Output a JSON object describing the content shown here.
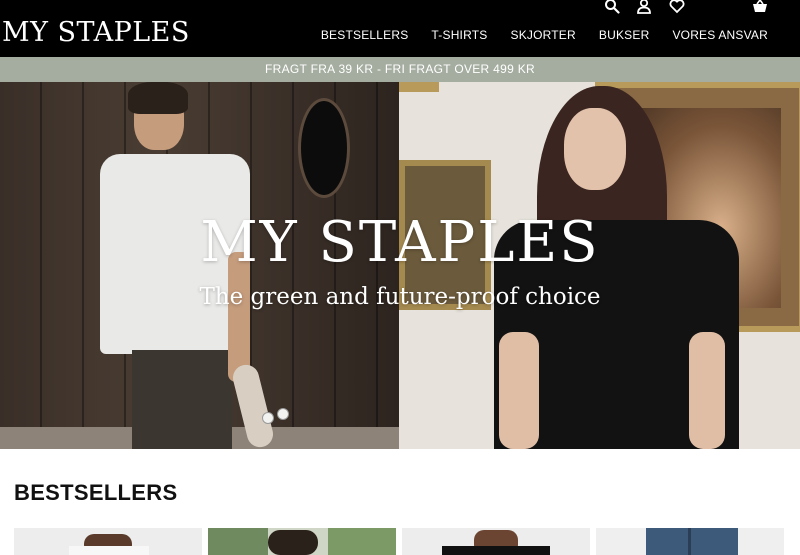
{
  "header": {
    "logo": "MY STAPLES",
    "nav": [
      "BESTSELLERS",
      "T-SHIRTS",
      "SKJORTER",
      "BUKSER",
      "VORES ANSVAR"
    ],
    "icons": [
      "search-icon",
      "account-icon",
      "wishlist-heart-icon",
      "basket-icon"
    ]
  },
  "announcement": "FRAGT FRA 39 KR - FRI FRAGT OVER 499 KR",
  "hero": {
    "title": "MY STAPLES",
    "subtitle": "The green and future-proof choice"
  },
  "bestsellers": {
    "title": "BESTSELLERS"
  },
  "colors": {
    "header_bg": "#000000",
    "announcement_bg": "#a4ad9f",
    "text_light": "#ffffff"
  }
}
